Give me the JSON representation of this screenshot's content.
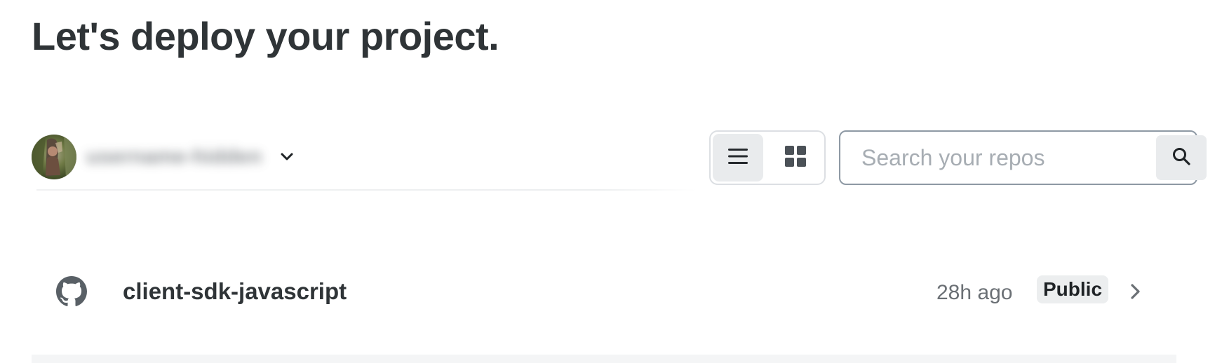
{
  "page": {
    "title": "Let's deploy your project."
  },
  "account": {
    "avatar_icon": "user-avatar",
    "name": "username-hidden",
    "dropdown_icon": "chevron-down-icon"
  },
  "view_toggle": {
    "list_icon": "list-icon",
    "grid_icon": "grid-icon",
    "active": "list"
  },
  "search": {
    "placeholder": "Search your repos",
    "value": "",
    "button_icon": "search-icon"
  },
  "repos": [
    {
      "icon": "github-icon",
      "name": "client-sdk-javascript",
      "updated": "28h ago",
      "visibility": "Public",
      "chevron_icon": "chevron-right-icon"
    }
  ],
  "colors": {
    "text": "#2f3437",
    "muted": "#6b7075",
    "toggle_active_bg": "#e9ebed",
    "search_border": "#8e99a4",
    "badge_bg": "#eceeef"
  }
}
